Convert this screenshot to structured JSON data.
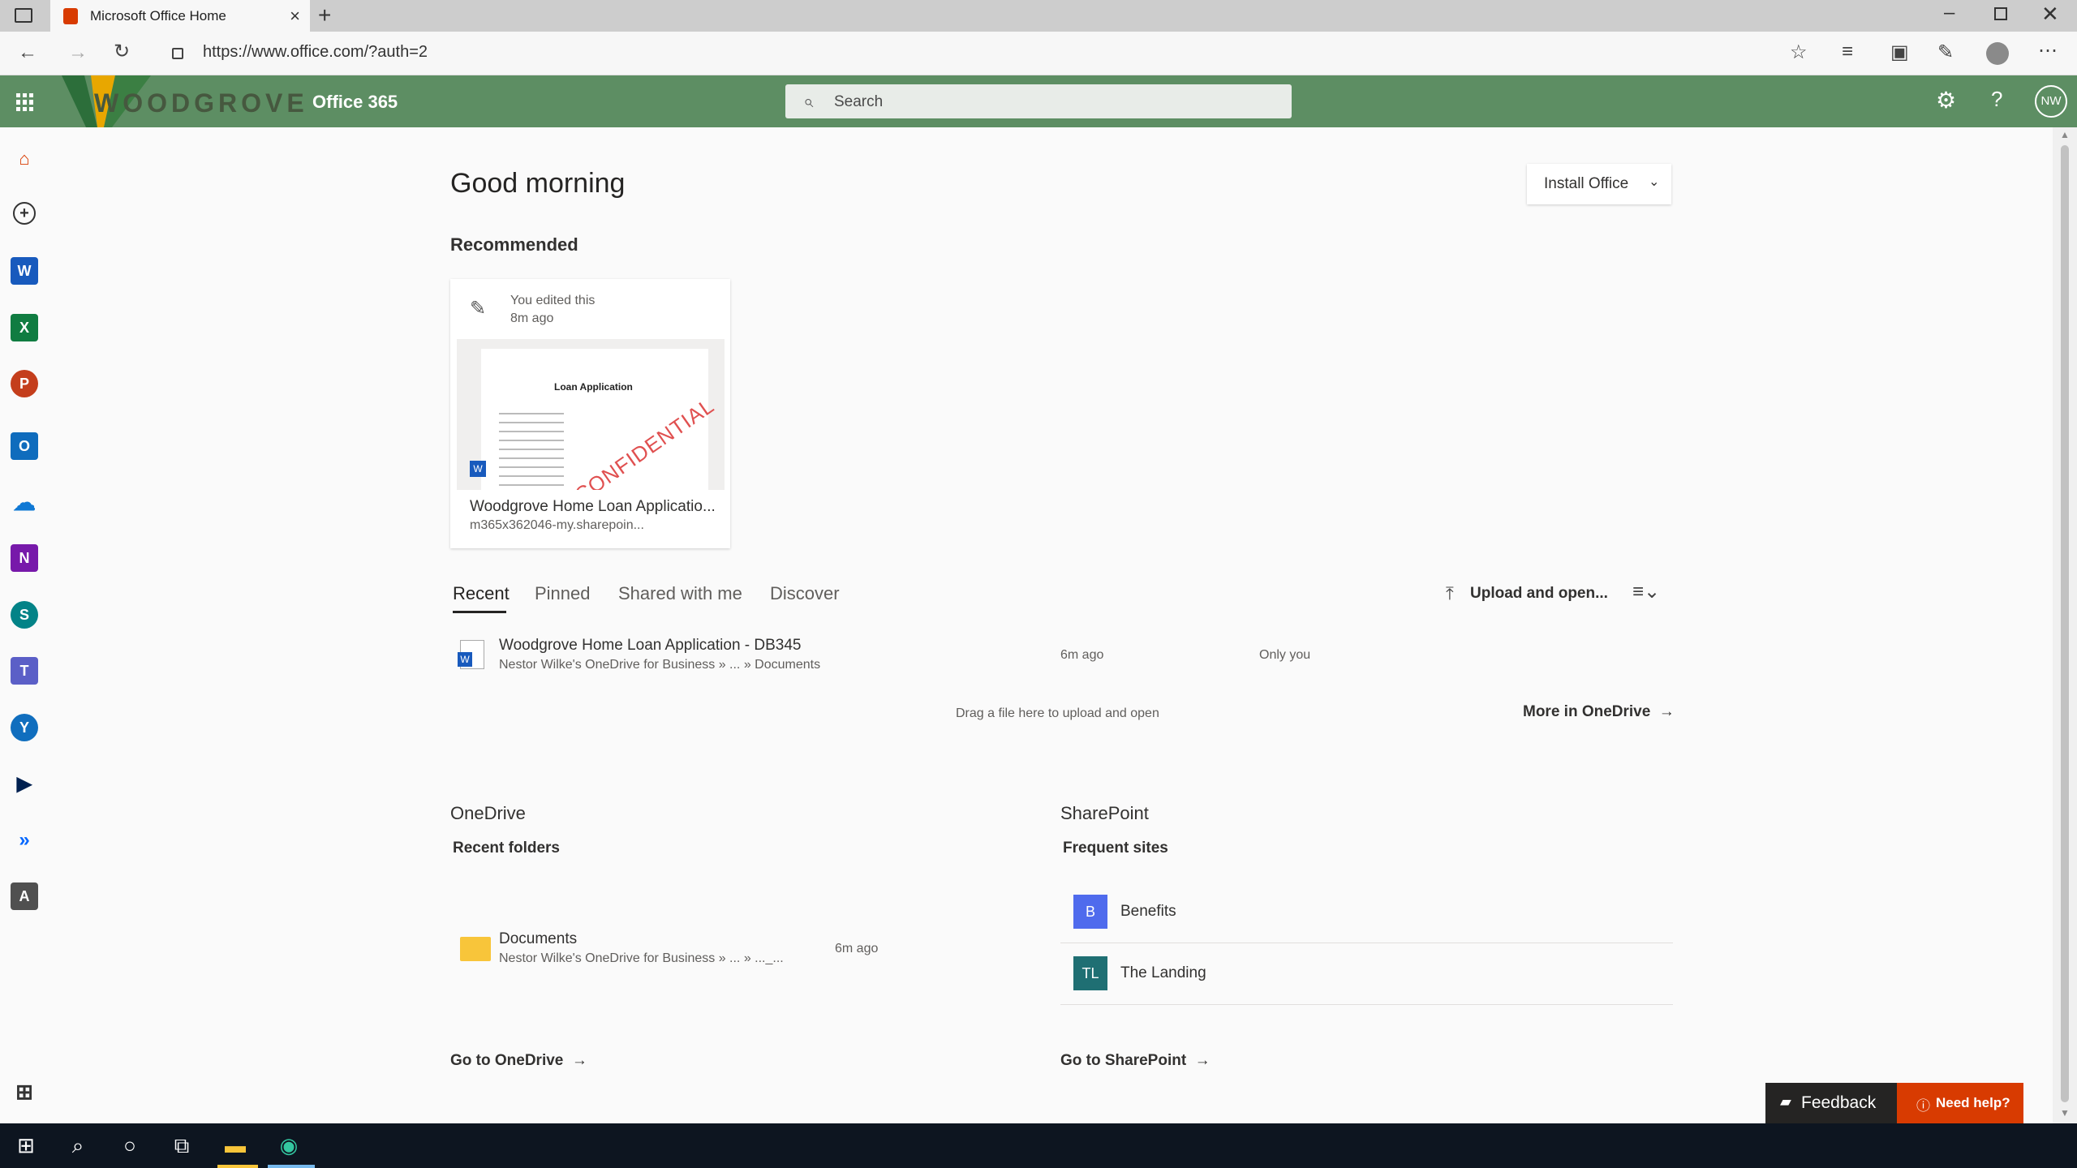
{
  "browser": {
    "tab_title": "Microsoft Office Home",
    "url": "https://www.office.com/?auth=2"
  },
  "header": {
    "brand_logo_text": "WOODGROVE",
    "app_title": "Office 365",
    "search_placeholder": "Search",
    "avatar_initials": "NW"
  },
  "main": {
    "greeting": "Good morning",
    "install_office": "Install Office",
    "recommended_title": "Recommended",
    "recommended_card": {
      "activity": "You edited this",
      "time": "8m ago",
      "doc_preview_title": "Loan Application",
      "stamp": "CONFIDENTIAL",
      "file_name": "Woodgrove Home Loan Applicatio...",
      "location": "m365x362046-my.sharepoin..."
    },
    "tabs": [
      "Recent",
      "Pinned",
      "Shared with me",
      "Discover"
    ],
    "upload_label": "Upload and open...",
    "recent_file": {
      "name": "Woodgrove Home Loan Application - DB345",
      "path": "Nestor Wilke's OneDrive for Business » ... » Documents",
      "time": "6m ago",
      "sharing": "Only you"
    },
    "drag_hint": "Drag a file here to upload and open",
    "more_onedrive": "More in OneDrive",
    "onedrive": {
      "title": "OneDrive",
      "subtitle": "Recent folders",
      "folder_name": "Documents",
      "folder_path": "Nestor Wilke's OneDrive for Business » ... » ..._...",
      "folder_time": "6m ago",
      "goto": "Go to OneDrive"
    },
    "sharepoint": {
      "title": "SharePoint",
      "subtitle": "Frequent sites",
      "sites": [
        {
          "initials": "B",
          "name": "Benefits",
          "color": "#4f6bed"
        },
        {
          "initials": "TL",
          "name": "The Landing",
          "color": "#1f6f73"
        }
      ],
      "goto": "Go to SharePoint"
    }
  },
  "footer": {
    "feedback": "Feedback",
    "need_help": "Need help?"
  },
  "colors": {
    "header_green": "#5d8e63",
    "need_help_red": "#d83b01",
    "feedback_dark": "#252423"
  }
}
